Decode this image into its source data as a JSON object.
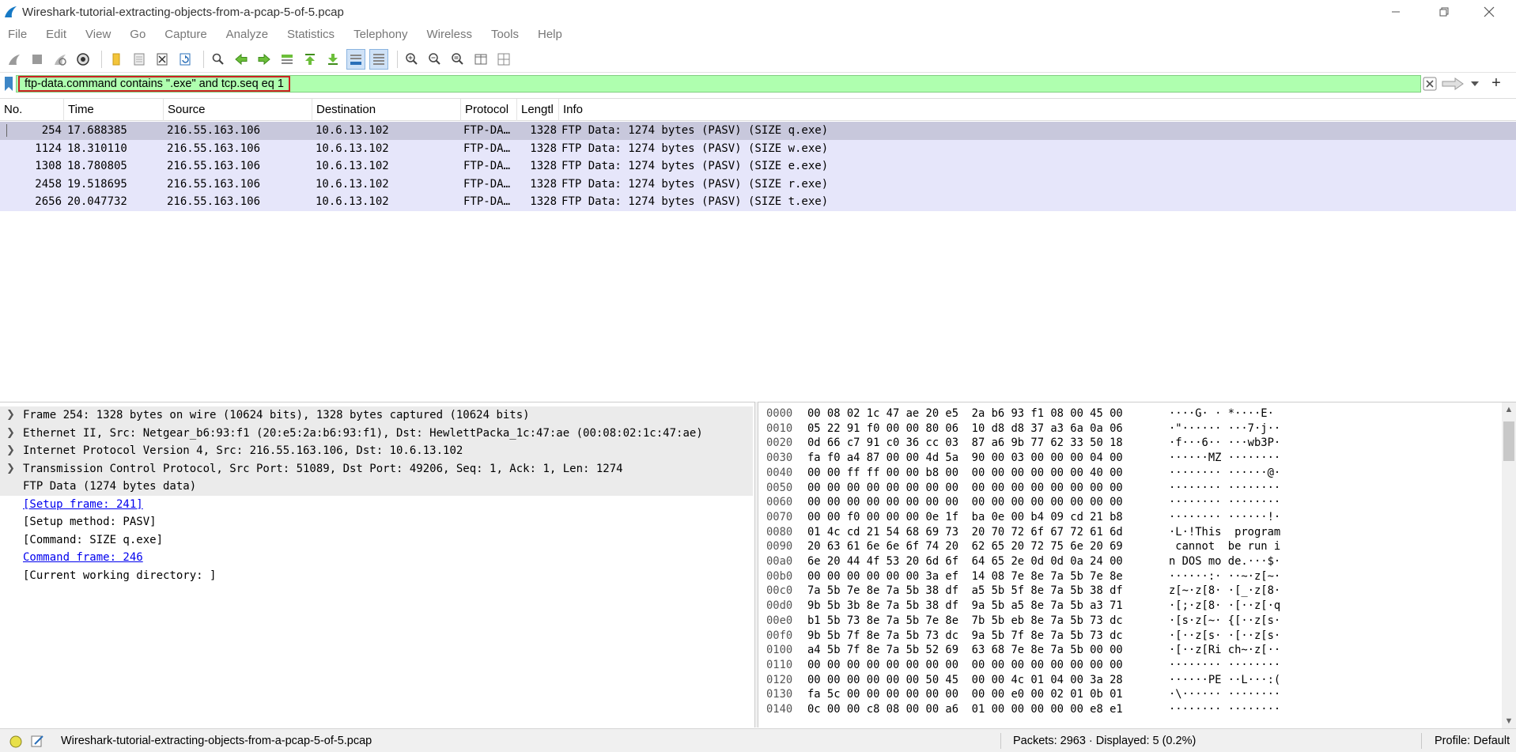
{
  "window": {
    "title": "Wireshark-tutorial-extracting-objects-from-a-pcap-5-of-5.pcap"
  },
  "menu": [
    "File",
    "Edit",
    "View",
    "Go",
    "Capture",
    "Analyze",
    "Statistics",
    "Telephony",
    "Wireless",
    "Tools",
    "Help"
  ],
  "toolbar": {
    "icons": [
      "shark-fin-start-icon",
      "stop-capture-icon",
      "restart-capture-icon",
      "capture-options-icon",
      "open-file-icon",
      "save-file-icon",
      "close-file-icon",
      "reload-file-icon",
      "find-packet-icon",
      "go-back-icon",
      "go-forward-icon",
      "go-to-packet-icon",
      "go-first-icon",
      "go-last-icon",
      "auto-scroll-icon",
      "colorize-icon",
      "zoom-in-icon",
      "zoom-out-icon",
      "normal-size-icon",
      "resize-columns-icon",
      "layout-icon"
    ]
  },
  "filter": {
    "value": "ftp-data.command contains \".exe\" and tcp.seq eq 1"
  },
  "packet_list": {
    "columns": [
      "No.",
      "Time",
      "Source",
      "Destination",
      "Protocol",
      "Lengtl",
      "Info"
    ],
    "rows": [
      {
        "no": "254",
        "time": "17.688385",
        "src": "216.55.163.106",
        "dst": "10.6.13.102",
        "proto": "FTP-DA…",
        "len": "1328",
        "info": "FTP Data: 1274 bytes (PASV) (SIZE q.exe)"
      },
      {
        "no": "1124",
        "time": "18.310110",
        "src": "216.55.163.106",
        "dst": "10.6.13.102",
        "proto": "FTP-DA…",
        "len": "1328",
        "info": "FTP Data: 1274 bytes (PASV) (SIZE w.exe)"
      },
      {
        "no": "1308",
        "time": "18.780805",
        "src": "216.55.163.106",
        "dst": "10.6.13.102",
        "proto": "FTP-DA…",
        "len": "1328",
        "info": "FTP Data: 1274 bytes (PASV) (SIZE e.exe)"
      },
      {
        "no": "2458",
        "time": "19.518695",
        "src": "216.55.163.106",
        "dst": "10.6.13.102",
        "proto": "FTP-DA…",
        "len": "1328",
        "info": "FTP Data: 1274 bytes (PASV) (SIZE r.exe)"
      },
      {
        "no": "2656",
        "time": "20.047732",
        "src": "216.55.163.106",
        "dst": "10.6.13.102",
        "proto": "FTP-DA…",
        "len": "1328",
        "info": "FTP Data: 1274 bytes (PASV) (SIZE t.exe)"
      }
    ]
  },
  "details": [
    {
      "text": "Frame 254: 1328 bytes on wire (10624 bits), 1328 bytes captured (10624 bits)",
      "expandable": true,
      "link": false
    },
    {
      "text": "Ethernet II, Src: Netgear_b6:93:f1 (20:e5:2a:b6:93:f1), Dst: HewlettPacka_1c:47:ae (00:08:02:1c:47:ae)",
      "expandable": true,
      "link": false
    },
    {
      "text": "Internet Protocol Version 4, Src: 216.55.163.106, Dst: 10.6.13.102",
      "expandable": true,
      "link": false
    },
    {
      "text": "Transmission Control Protocol, Src Port: 51089, Dst Port: 49206, Seq: 1, Ack: 1, Len: 1274",
      "expandable": true,
      "link": false
    },
    {
      "text": "FTP Data (1274 bytes data)",
      "expandable": false,
      "link": false
    },
    {
      "text": "[Setup frame: 241]",
      "expandable": false,
      "link": true
    },
    {
      "text": "[Setup method: PASV]",
      "expandable": false,
      "link": false
    },
    {
      "text": "[Command: SIZE q.exe]",
      "expandable": false,
      "link": false
    },
    {
      "text": "Command frame: 246",
      "expandable": false,
      "link": true
    },
    {
      "text": "[Current working directory: ]",
      "expandable": false,
      "link": false
    }
  ],
  "bytes": [
    {
      "off": "0000",
      "hex": "00 08 02 1c 47 ae 20 e5  2a b6 93 f1 08 00 45 00",
      "ascii": "····G· · *····E·"
    },
    {
      "off": "0010",
      "hex": "05 22 91 f0 00 00 80 06  10 d8 d8 37 a3 6a 0a 06",
      "ascii": "·\"······ ···7·j··"
    },
    {
      "off": "0020",
      "hex": "0d 66 c7 91 c0 36 cc 03  87 a6 9b 77 62 33 50 18",
      "ascii": "·f···6·· ···wb3P·"
    },
    {
      "off": "0030",
      "hex": "fa f0 a4 87 00 00 4d 5a  90 00 03 00 00 00 04 00",
      "ascii": "······MZ ········"
    },
    {
      "off": "0040",
      "hex": "00 00 ff ff 00 00 b8 00  00 00 00 00 00 00 40 00",
      "ascii": "········ ······@·"
    },
    {
      "off": "0050",
      "hex": "00 00 00 00 00 00 00 00  00 00 00 00 00 00 00 00",
      "ascii": "········ ········"
    },
    {
      "off": "0060",
      "hex": "00 00 00 00 00 00 00 00  00 00 00 00 00 00 00 00",
      "ascii": "········ ········"
    },
    {
      "off": "0070",
      "hex": "00 00 f0 00 00 00 0e 1f  ba 0e 00 b4 09 cd 21 b8",
      "ascii": "········ ······!·"
    },
    {
      "off": "0080",
      "hex": "01 4c cd 21 54 68 69 73  20 70 72 6f 67 72 61 6d",
      "ascii": "·L·!This  program"
    },
    {
      "off": "0090",
      "hex": "20 63 61 6e 6e 6f 74 20  62 65 20 72 75 6e 20 69",
      "ascii": " cannot  be run i"
    },
    {
      "off": "00a0",
      "hex": "6e 20 44 4f 53 20 6d 6f  64 65 2e 0d 0d 0a 24 00",
      "ascii": "n DOS mo de.···$·"
    },
    {
      "off": "00b0",
      "hex": "00 00 00 00 00 00 3a ef  14 08 7e 8e 7a 5b 7e 8e",
      "ascii": "······:· ··~·z[~·"
    },
    {
      "off": "00c0",
      "hex": "7a 5b 7e 8e 7a 5b 38 df  a5 5b 5f 8e 7a 5b 38 df",
      "ascii": "z[~·z[8· ·[_·z[8·"
    },
    {
      "off": "00d0",
      "hex": "9b 5b 3b 8e 7a 5b 38 df  9a 5b a5 8e 7a 5b a3 71",
      "ascii": "·[;·z[8· ·[··z[·q"
    },
    {
      "off": "00e0",
      "hex": "b1 5b 73 8e 7a 5b 7e 8e  7b 5b eb 8e 7a 5b 73 dc",
      "ascii": "·[s·z[~· {[··z[s·"
    },
    {
      "off": "00f0",
      "hex": "9b 5b 7f 8e 7a 5b 73 dc  9a 5b 7f 8e 7a 5b 73 dc",
      "ascii": "·[··z[s· ·[··z[s·"
    },
    {
      "off": "0100",
      "hex": "a4 5b 7f 8e 7a 5b 52 69  63 68 7e 8e 7a 5b 00 00",
      "ascii": "·[··z[Ri ch~·z[··"
    },
    {
      "off": "0110",
      "hex": "00 00 00 00 00 00 00 00  00 00 00 00 00 00 00 00",
      "ascii": "········ ········"
    },
    {
      "off": "0120",
      "hex": "00 00 00 00 00 00 50 45  00 00 4c 01 04 00 3a 28",
      "ascii": "······PE ··L···:("
    },
    {
      "off": "0130",
      "hex": "fa 5c 00 00 00 00 00 00  00 00 e0 00 02 01 0b 01",
      "ascii": "·\\······ ········"
    },
    {
      "off": "0140",
      "hex": "0c 00 00 c8 08 00 00 a6  01 00 00 00 00 00 e8 e1",
      "ascii": "········ ········"
    }
  ],
  "status": {
    "file": "Wireshark-tutorial-extracting-objects-from-a-pcap-5-of-5.pcap",
    "packets": "Packets: 2963 · Displayed: 5 (0.2%)",
    "profile": "Profile: Default"
  },
  "colors": {
    "filter_valid": "#afffaf",
    "row_bg": "#e6e6fa",
    "row_selected": "#c8c8dc",
    "link": "#0000ee",
    "highlight_border": "#cc2222"
  }
}
